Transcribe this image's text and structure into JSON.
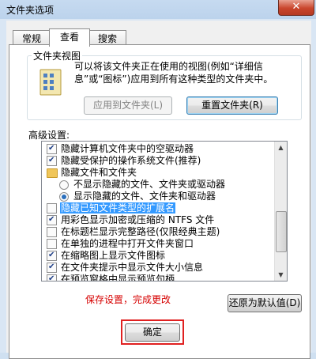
{
  "window": {
    "title": "文件夹选项",
    "close_label": "✕"
  },
  "tabs": [
    {
      "label": "常规",
      "selected": false
    },
    {
      "label": "查看",
      "selected": true
    },
    {
      "label": "搜索",
      "selected": false
    }
  ],
  "folder_views": {
    "group_label": "文件夹视图",
    "description": "可以将该文件夹正在使用的视图(例如“详细信息”或“图标”)应用到所有这种类型的文件夹中。",
    "apply_button": "应用到文件夹(L)",
    "reset_button": "重置文件夹(R)"
  },
  "advanced": {
    "label": "高级设置:",
    "items": [
      {
        "type": "checkbox",
        "checked": true,
        "label": "隐藏计算机文件夹中的空驱动器"
      },
      {
        "type": "checkbox",
        "checked": true,
        "label": "隐藏受保护的操作系统文件(推荐)"
      },
      {
        "type": "folder",
        "label": "隐藏文件和文件夹"
      },
      {
        "type": "radio",
        "checked": false,
        "label": "不显示隐藏的文件、文件夹或驱动器"
      },
      {
        "type": "radio",
        "checked": true,
        "label": "显示隐藏的文件、文件夹和驱动器"
      },
      {
        "type": "checkbox",
        "checked": false,
        "label": "隐藏已知文件类型的扩展名",
        "highlight": true
      },
      {
        "type": "checkbox",
        "checked": true,
        "label": "用彩色显示加密或压缩的 NTFS 文件"
      },
      {
        "type": "checkbox",
        "checked": false,
        "label": "在标题栏显示完整路径(仅限经典主题)"
      },
      {
        "type": "checkbox",
        "checked": false,
        "label": "在单独的进程中打开文件夹窗口"
      },
      {
        "type": "checkbox",
        "checked": true,
        "label": "在缩略图上显示文件图标"
      },
      {
        "type": "checkbox",
        "checked": true,
        "label": "在文件夹提示中显示文件大小信息"
      },
      {
        "type": "checkbox",
        "checked": true,
        "label": "在预览窗格中显示预览句柄"
      }
    ]
  },
  "restore_button": "还原为默认值(D)",
  "annotation": "保存设置，完成更改",
  "ok_button": "确定",
  "colors": {
    "highlight": "#3399ff",
    "annotation": "#d60000",
    "window_frame": "#d9e6f4"
  }
}
